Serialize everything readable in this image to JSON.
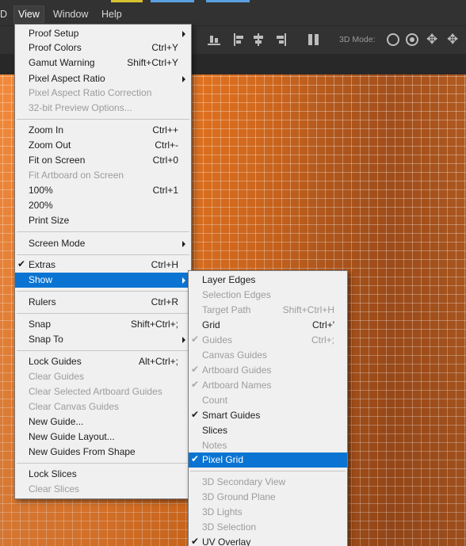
{
  "colors": {
    "menu_bg": "#f0f0f0",
    "highlight": "#0b74d2",
    "disabled_text": "#9c9c9c",
    "canvas_orange": "#e2751f"
  },
  "menubar": {
    "items": [
      {
        "label": "D"
      },
      {
        "label": "View",
        "active": true
      },
      {
        "label": "Window"
      },
      {
        "label": "Help"
      }
    ]
  },
  "optionsbar": {
    "mode_label": "3D Mode:"
  },
  "view_menu": {
    "items": [
      {
        "label": "Proof Setup",
        "submenu": true
      },
      {
        "label": "Proof Colors",
        "shortcut": "Ctrl+Y"
      },
      {
        "label": "Gamut Warning",
        "shortcut": "Shift+Ctrl+Y"
      },
      {
        "label": "Pixel Aspect Ratio",
        "submenu": true
      },
      {
        "label": "Pixel Aspect Ratio Correction",
        "disabled": true
      },
      {
        "label": "32-bit Preview Options...",
        "disabled": true
      },
      {
        "label": "Zoom In",
        "shortcut": "Ctrl++"
      },
      {
        "label": "Zoom Out",
        "shortcut": "Ctrl+-"
      },
      {
        "label": "Fit on Screen",
        "shortcut": "Ctrl+0"
      },
      {
        "label": "Fit Artboard on Screen",
        "disabled": true
      },
      {
        "label": "100%",
        "shortcut": "Ctrl+1"
      },
      {
        "label": "200%"
      },
      {
        "label": "Print Size"
      },
      {
        "label": "Screen Mode",
        "submenu": true
      },
      {
        "label": "Extras",
        "shortcut": "Ctrl+H",
        "checked": true
      },
      {
        "label": "Show",
        "submenu": true,
        "highlighted": true
      },
      {
        "label": "Rulers",
        "shortcut": "Ctrl+R"
      },
      {
        "label": "Snap",
        "shortcut": "Shift+Ctrl+;"
      },
      {
        "label": "Snap To",
        "submenu": true
      },
      {
        "label": "Lock Guides",
        "shortcut": "Alt+Ctrl+;"
      },
      {
        "label": "Clear Guides",
        "disabled": true
      },
      {
        "label": "Clear Selected Artboard Guides",
        "disabled": true
      },
      {
        "label": "Clear Canvas Guides",
        "disabled": true
      },
      {
        "label": "New Guide..."
      },
      {
        "label": "New Guide Layout..."
      },
      {
        "label": "New Guides From Shape"
      },
      {
        "label": "Lock Slices"
      },
      {
        "label": "Clear Slices",
        "disabled": true
      }
    ]
  },
  "show_submenu": {
    "items": [
      {
        "label": "Layer Edges"
      },
      {
        "label": "Selection Edges",
        "disabled": true
      },
      {
        "label": "Target Path",
        "shortcut": "Shift+Ctrl+H",
        "disabled": true
      },
      {
        "label": "Grid",
        "shortcut": "Ctrl+'"
      },
      {
        "label": "Guides",
        "shortcut": "Ctrl+;",
        "disabled": true,
        "checked": true
      },
      {
        "label": "Canvas Guides",
        "disabled": true
      },
      {
        "label": "Artboard Guides",
        "disabled": true,
        "checked": true
      },
      {
        "label": "Artboard Names",
        "disabled": true,
        "checked": true
      },
      {
        "label": "Count",
        "disabled": true
      },
      {
        "label": "Smart Guides",
        "checked": true
      },
      {
        "label": "Slices"
      },
      {
        "label": "Notes",
        "disabled": true
      },
      {
        "label": "Pixel Grid",
        "checked": true,
        "highlighted": true
      },
      {
        "label": "3D Secondary View",
        "disabled": true
      },
      {
        "label": "3D Ground Plane",
        "disabled": true
      },
      {
        "label": "3D Lights",
        "disabled": true
      },
      {
        "label": "3D Selection",
        "disabled": true
      },
      {
        "label": "UV Overlay",
        "checked": true
      }
    ]
  }
}
